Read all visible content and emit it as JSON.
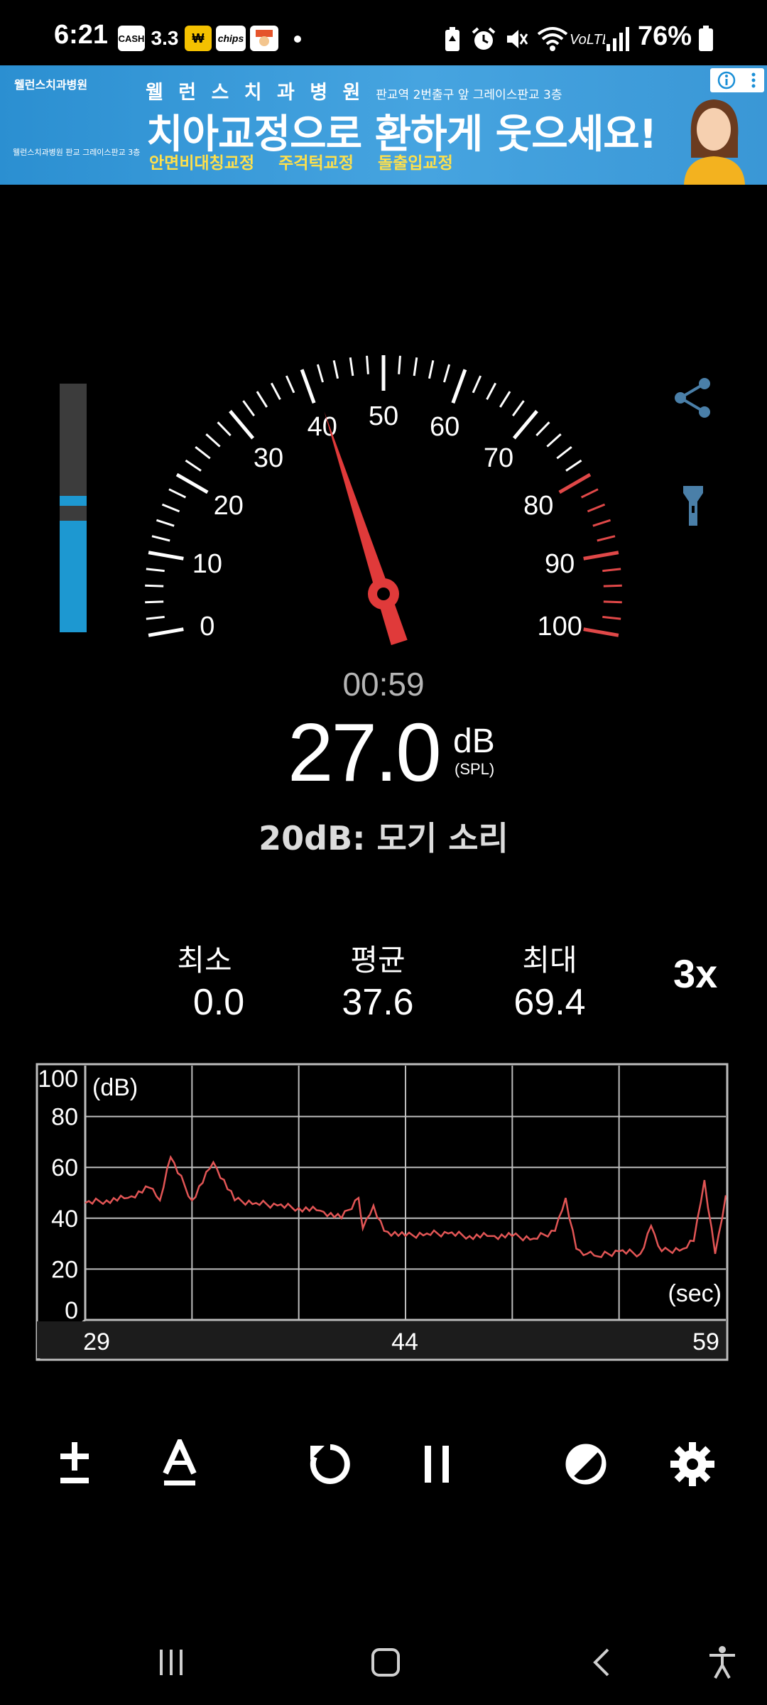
{
  "status_bar": {
    "time": "6:21",
    "badges": [
      "CASH",
      "3.3",
      "chips"
    ],
    "battery": "76%"
  },
  "ad": {
    "logo": "웰런스치과병원",
    "top_line": "웰 런 스 치 과 병 원",
    "top_line_sub": "판교역 2번출구 앞 그레이스판교 3층",
    "headline": "치아교정으로 환하게 웃으세요!",
    "features": [
      "안면비대칭교정",
      "주걱턱교정",
      "돌출입교정"
    ],
    "left_small": "웰런스치과병원 판교 그레이스판교 3층"
  },
  "gauge": {
    "ticks": [
      "0",
      "10",
      "20",
      "30",
      "40",
      "50",
      "60",
      "70",
      "80",
      "90",
      "100"
    ],
    "needle_value": 41,
    "red_zone_from": 80,
    "colors": {
      "needle": "#e03a3a",
      "red_zone": "#e04848",
      "scale": "#ffffff"
    }
  },
  "level_bar": {
    "level": 0.45,
    "peak": 0.55
  },
  "reading": {
    "timer": "00:59",
    "value": "27.0",
    "unit": "dB",
    "unit_sub": "(SPL)",
    "reference": "20dB: 모기 소리"
  },
  "stats": {
    "min_label": "최소",
    "min_value": "0.0",
    "avg_label": "평균",
    "avg_value": "37.6",
    "max_label": "최대",
    "max_value": "69.4",
    "speed": "3x"
  },
  "chart_data": {
    "type": "line",
    "ylabel": "(dB)",
    "xlabel": "(sec)",
    "y_ticks": [
      "100",
      "80",
      "60",
      "40",
      "20",
      "0"
    ],
    "x_ticks": [
      "29",
      "44",
      "59"
    ],
    "xlim": [
      29,
      59
    ],
    "ylim": [
      0,
      100
    ],
    "series": [
      {
        "color": "#e25555",
        "x": [
          29,
          30,
          31,
          32,
          32.5,
          33,
          34,
          35,
          36,
          37,
          38,
          39,
          40,
          41,
          41.8,
          42,
          42.5,
          43,
          44,
          45,
          46,
          47,
          48,
          49,
          50,
          51,
          51.5,
          52,
          52.5,
          53,
          54,
          55,
          55.5,
          56,
          57,
          57.5,
          58,
          58.5,
          59
        ],
        "y": [
          46,
          47,
          48,
          52,
          47,
          64,
          47,
          62,
          47,
          46,
          45,
          44,
          43,
          40,
          48,
          36,
          45,
          35,
          33,
          34,
          34,
          33,
          33,
          33,
          32,
          35,
          48,
          28,
          26,
          25,
          27,
          26,
          37,
          27,
          28,
          31,
          55,
          26,
          49
        ]
      }
    ]
  },
  "toolbar": [
    "plus-minus-icon",
    "a-underline-icon",
    "reset-icon",
    "pause-icon",
    "theme-icon",
    "gear-icon"
  ],
  "navigation": [
    "recent-apps-icon",
    "home-icon",
    "back-icon",
    "accessibility-icon"
  ]
}
